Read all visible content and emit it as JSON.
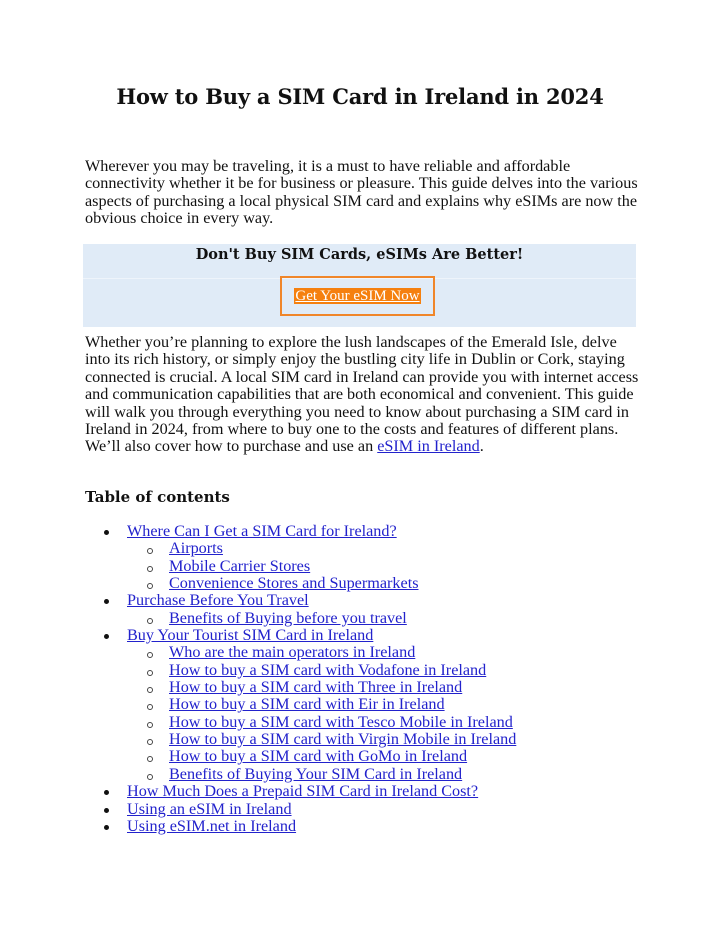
{
  "page": {
    "title": "How to Buy a SIM Card in Ireland in 2024",
    "intro": "Wherever you may be traveling, it is a must to have reliable and affordable connectivity whether it be for business or pleasure. This guide delves into the various aspects of purchasing a local physical SIM card and explains why eSIMs are now the obvious choice in every way.",
    "callout": {
      "heading": "Don't Buy SIM Cards, eSIMs Are Better!",
      "button_label": "Get Your eSIM Now",
      "button_color": "#f5800f",
      "background_color": "#e0ebf7"
    },
    "body": {
      "text": "Whether you’re planning to explore the lush landscapes of the Emerald Isle, delve into its rich history, or simply enjoy the bustling city life in Dublin or Cork, staying connected is crucial. A local SIM card in Ireland can provide you with internet access and communication capabilities that are both economical and convenient. This guide will walk you through everything you need to know about purchasing a SIM card in Ireland in 2024, from where to buy one to the costs and features of different plans. We’ll also cover how to purchase and use an ",
      "link_text": "eSIM in Ireland",
      "trailing": "."
    },
    "toc": {
      "heading": "Table of contents",
      "items": [
        {
          "label": "Where Can I Get a SIM Card for Ireland?",
          "level": 1
        },
        {
          "label": "Airports",
          "level": 2
        },
        {
          "label": "Mobile Carrier Stores",
          "level": 2
        },
        {
          "label": "Convenience Stores and Supermarkets",
          "level": 2
        },
        {
          "label": "Purchase Before You Travel",
          "level": 1
        },
        {
          "label": "Benefits of Buying before you travel",
          "level": 2
        },
        {
          "label": "Buy Your Tourist SIM Card in Ireland",
          "level": 1
        },
        {
          "label": "Who are the main operators in Ireland",
          "level": 2
        },
        {
          "label": "How to buy a SIM card with Vodafone in Ireland",
          "level": 2
        },
        {
          "label": "How to buy a SIM card with Three in Ireland",
          "level": 2
        },
        {
          "label": "How to buy a SIM card with Eir in Ireland",
          "level": 2
        },
        {
          "label": "How to buy a SIM card with Tesco Mobile in Ireland",
          "level": 2
        },
        {
          "label": "How to buy a SIM card with Virgin Mobile in Ireland",
          "level": 2
        },
        {
          "label": "How to buy a SIM card with GoMo in Ireland",
          "level": 2
        },
        {
          "label": "Benefits of Buying Your SIM Card in Ireland",
          "level": 2
        },
        {
          "label": "How Much Does a Prepaid SIM Card in Ireland Cost?",
          "level": 1
        },
        {
          "label": "Using an eSIM in Ireland",
          "level": 1
        },
        {
          "label": "Using eSIM.net in Ireland",
          "level": 1
        }
      ]
    }
  }
}
